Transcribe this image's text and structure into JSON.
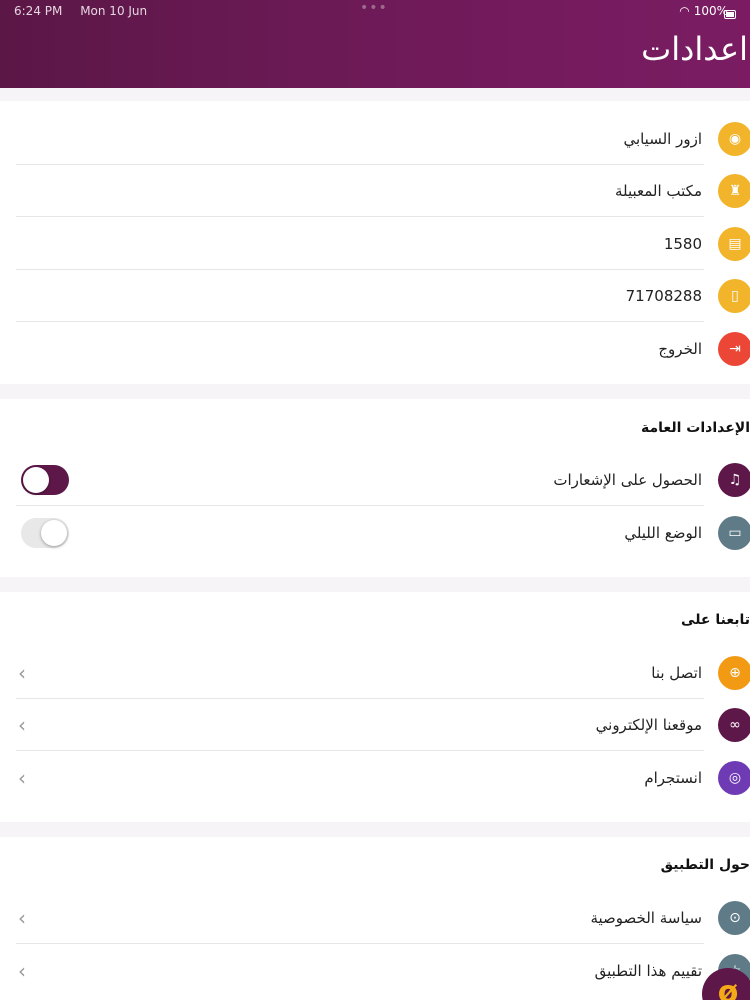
{
  "status_bar": {
    "time": "6:24 PM",
    "date": "Mon 10 Jun",
    "dots": "•••",
    "battery": "100%"
  },
  "header": {
    "title": "اعدادات"
  },
  "profile": {
    "items": [
      {
        "label": "ازور السيابي",
        "icon": "globe-user-icon",
        "color": "#f2b42a",
        "glyph": "◉"
      },
      {
        "label": "مكتب المعبيلة",
        "icon": "office-person-icon",
        "color": "#f2b42a",
        "glyph": "♜"
      },
      {
        "label": "1580",
        "icon": "id-card-icon",
        "color": "#f2b42a",
        "glyph": "▤"
      },
      {
        "label": "71708288",
        "icon": "phone-icon",
        "color": "#f2b42a",
        "glyph": "▯"
      },
      {
        "label": "الخروج",
        "icon": "logout-icon",
        "color": "#ec4736",
        "glyph": "⇥"
      }
    ]
  },
  "general": {
    "title": "الإعدادات العامة",
    "items": [
      {
        "label": "الحصول على الإشعارات",
        "icon": "bell-icon",
        "color": "#5e1749",
        "glyph": "♫",
        "state": "on"
      },
      {
        "label": "الوضع الليلي",
        "icon": "monitor-icon",
        "color": "#5f7b87",
        "glyph": "▭",
        "state": "off"
      }
    ]
  },
  "follow": {
    "title": "تابعنا على",
    "items": [
      {
        "label": "اتصل بنا",
        "icon": "globe-icon",
        "color": "#f39a14",
        "glyph": "⊕",
        "chevron": "‹"
      },
      {
        "label": "موقعنا الإلكتروني",
        "icon": "link-icon",
        "color": "#5e1749",
        "glyph": "∞",
        "chevron": "‹"
      },
      {
        "label": "انستجرام",
        "icon": "instagram-icon",
        "color": "#6e3bb5",
        "glyph": "◎",
        "chevron": "‹"
      }
    ]
  },
  "about": {
    "title": "حول التطبيق",
    "items": [
      {
        "label": "سياسة الخصوصية",
        "icon": "privacy-lock-icon",
        "color": "#5f7b87",
        "glyph": "⊙",
        "chevron": "‹"
      },
      {
        "label": "تقييم هذا التطبيق",
        "icon": "star-icon",
        "color": "#5f7b87",
        "glyph": "☆",
        "chevron": "‹"
      }
    ]
  },
  "fab": {
    "glyph": "ø"
  }
}
